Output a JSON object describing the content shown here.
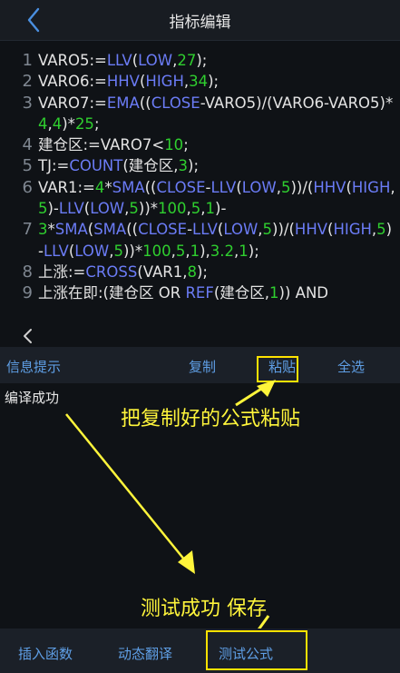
{
  "header": {
    "title": "指标编辑",
    "back_icon": "chevron-left-icon"
  },
  "editor": {
    "lines": [
      {
        "number": "1",
        "tokens": [
          {
            "t": "VARO5:=",
            "c": "txt"
          },
          {
            "t": "LLV",
            "c": "fn"
          },
          {
            "t": "(",
            "c": "txt"
          },
          {
            "t": "LOW",
            "c": "fn"
          },
          {
            "t": ",",
            "c": "txt"
          },
          {
            "t": "27",
            "c": "num"
          },
          {
            "t": ");",
            "c": "txt"
          }
        ]
      },
      {
        "number": "2",
        "tokens": [
          {
            "t": "VARO6:=",
            "c": "txt"
          },
          {
            "t": "HHV",
            "c": "fn"
          },
          {
            "t": "(",
            "c": "txt"
          },
          {
            "t": "HIGH",
            "c": "fn"
          },
          {
            "t": ",",
            "c": "txt"
          },
          {
            "t": "34",
            "c": "num"
          },
          {
            "t": ");",
            "c": "txt"
          }
        ]
      },
      {
        "number": "3",
        "tokens": [
          {
            "t": "VARO7:=",
            "c": "txt"
          },
          {
            "t": "EMA",
            "c": "fn"
          },
          {
            "t": "((",
            "c": "txt"
          },
          {
            "t": "CLOSE",
            "c": "fn"
          },
          {
            "t": "-VARO5)/(VARO6-VARO5)*",
            "c": "txt"
          },
          {
            "t": "4",
            "c": "num"
          },
          {
            "t": ",",
            "c": "txt"
          },
          {
            "t": "4",
            "c": "num"
          },
          {
            "t": ")*",
            "c": "txt"
          },
          {
            "t": "25",
            "c": "num"
          },
          {
            "t": ";",
            "c": "txt"
          }
        ]
      },
      {
        "number": "4",
        "tokens": [
          {
            "t": "建仓区:=VARO7<",
            "c": "txt"
          },
          {
            "t": "10",
            "c": "num"
          },
          {
            "t": ";",
            "c": "txt"
          }
        ]
      },
      {
        "number": "5",
        "tokens": [
          {
            "t": "TJ:=",
            "c": "txt"
          },
          {
            "t": "COUNT",
            "c": "fn"
          },
          {
            "t": "(建仓区,",
            "c": "txt"
          },
          {
            "t": "3",
            "c": "num"
          },
          {
            "t": ");",
            "c": "txt"
          }
        ]
      },
      {
        "number": "6",
        "tokens": [
          {
            "t": "VAR1:=",
            "c": "txt"
          },
          {
            "t": "4",
            "c": "num"
          },
          {
            "t": "*",
            "c": "txt"
          },
          {
            "t": "SMA",
            "c": "fn"
          },
          {
            "t": "((",
            "c": "txt"
          },
          {
            "t": "CLOSE",
            "c": "fn"
          },
          {
            "t": "-",
            "c": "txt"
          },
          {
            "t": "LLV",
            "c": "fn"
          },
          {
            "t": "(",
            "c": "txt"
          },
          {
            "t": "LOW",
            "c": "fn"
          },
          {
            "t": ",",
            "c": "txt"
          },
          {
            "t": "5",
            "c": "num"
          },
          {
            "t": "))/(",
            "c": "txt"
          },
          {
            "t": "HHV",
            "c": "fn"
          },
          {
            "t": "(",
            "c": "txt"
          },
          {
            "t": "HIGH",
            "c": "fn"
          },
          {
            "t": ",",
            "c": "txt"
          },
          {
            "t": "5",
            "c": "num"
          },
          {
            "t": ")-",
            "c": "txt"
          },
          {
            "t": "LLV",
            "c": "fn"
          },
          {
            "t": "(",
            "c": "txt"
          },
          {
            "t": "LOW",
            "c": "fn"
          },
          {
            "t": ",",
            "c": "txt"
          },
          {
            "t": "5",
            "c": "num"
          },
          {
            "t": "))*",
            "c": "txt"
          },
          {
            "t": "100",
            "c": "num"
          },
          {
            "t": ",",
            "c": "txt"
          },
          {
            "t": "5",
            "c": "num"
          },
          {
            "t": ",",
            "c": "txt"
          },
          {
            "t": "1",
            "c": "num"
          },
          {
            "t": ")-",
            "c": "txt"
          }
        ]
      },
      {
        "number": "7",
        "tokens": [
          {
            "t": "3",
            "c": "num"
          },
          {
            "t": "*",
            "c": "txt"
          },
          {
            "t": "SMA",
            "c": "fn"
          },
          {
            "t": "(",
            "c": "txt"
          },
          {
            "t": "SMA",
            "c": "fn"
          },
          {
            "t": "((",
            "c": "txt"
          },
          {
            "t": "CLOSE",
            "c": "fn"
          },
          {
            "t": "-",
            "c": "txt"
          },
          {
            "t": "LLV",
            "c": "fn"
          },
          {
            "t": "(",
            "c": "txt"
          },
          {
            "t": "LOW",
            "c": "fn"
          },
          {
            "t": ",",
            "c": "txt"
          },
          {
            "t": "5",
            "c": "num"
          },
          {
            "t": "))/(",
            "c": "txt"
          },
          {
            "t": "HHV",
            "c": "fn"
          },
          {
            "t": "(",
            "c": "txt"
          },
          {
            "t": "HIGH",
            "c": "fn"
          },
          {
            "t": ",",
            "c": "txt"
          },
          {
            "t": "5",
            "c": "num"
          },
          {
            "t": ")-",
            "c": "txt"
          },
          {
            "t": "LLV",
            "c": "fn"
          },
          {
            "t": "(",
            "c": "txt"
          },
          {
            "t": "LOW",
            "c": "fn"
          },
          {
            "t": ",",
            "c": "txt"
          },
          {
            "t": "5",
            "c": "num"
          },
          {
            "t": "))*",
            "c": "txt"
          },
          {
            "t": "100",
            "c": "num"
          },
          {
            "t": ",",
            "c": "txt"
          },
          {
            "t": "5",
            "c": "num"
          },
          {
            "t": ",",
            "c": "txt"
          },
          {
            "t": "1",
            "c": "num"
          },
          {
            "t": "),",
            "c": "txt"
          },
          {
            "t": "3.2",
            "c": "num"
          },
          {
            "t": ",",
            "c": "txt"
          },
          {
            "t": "1",
            "c": "num"
          },
          {
            "t": ");",
            "c": "txt"
          }
        ]
      },
      {
        "number": "8",
        "tokens": [
          {
            "t": "上涨:=",
            "c": "txt"
          },
          {
            "t": "CROSS",
            "c": "fn"
          },
          {
            "t": "(VAR1,",
            "c": "txt"
          },
          {
            "t": "8",
            "c": "num"
          },
          {
            "t": ");",
            "c": "txt"
          }
        ]
      },
      {
        "number": "9",
        "tokens": [
          {
            "t": "上涨在即:(建仓区 OR ",
            "c": "txt"
          },
          {
            "t": "REF",
            "c": "fn"
          },
          {
            "t": "(建仓区,",
            "c": "txt"
          },
          {
            "t": "1",
            "c": "num"
          },
          {
            "t": ")) AND",
            "c": "txt"
          }
        ]
      }
    ]
  },
  "toolbar": {
    "info_label": "信息提示",
    "copy_label": "复制",
    "paste_label": "粘贴",
    "select_all_label": "全选"
  },
  "status": {
    "text": "编译成功"
  },
  "annotations": {
    "paste_hint": "把复制好的公式粘贴",
    "save_hint": "测试成功  保存"
  },
  "bottom_bar": {
    "insert_function_label": "插入函数",
    "dynamic_translate_label": "动态翻译",
    "test_formula_label": "测试公式"
  },
  "colors": {
    "background": "#0f1216",
    "function_token": "#6b7cf6",
    "number_token": "#2fcf2f",
    "link_blue": "#5f9fe6",
    "annotation_yellow": "#fff53b"
  }
}
